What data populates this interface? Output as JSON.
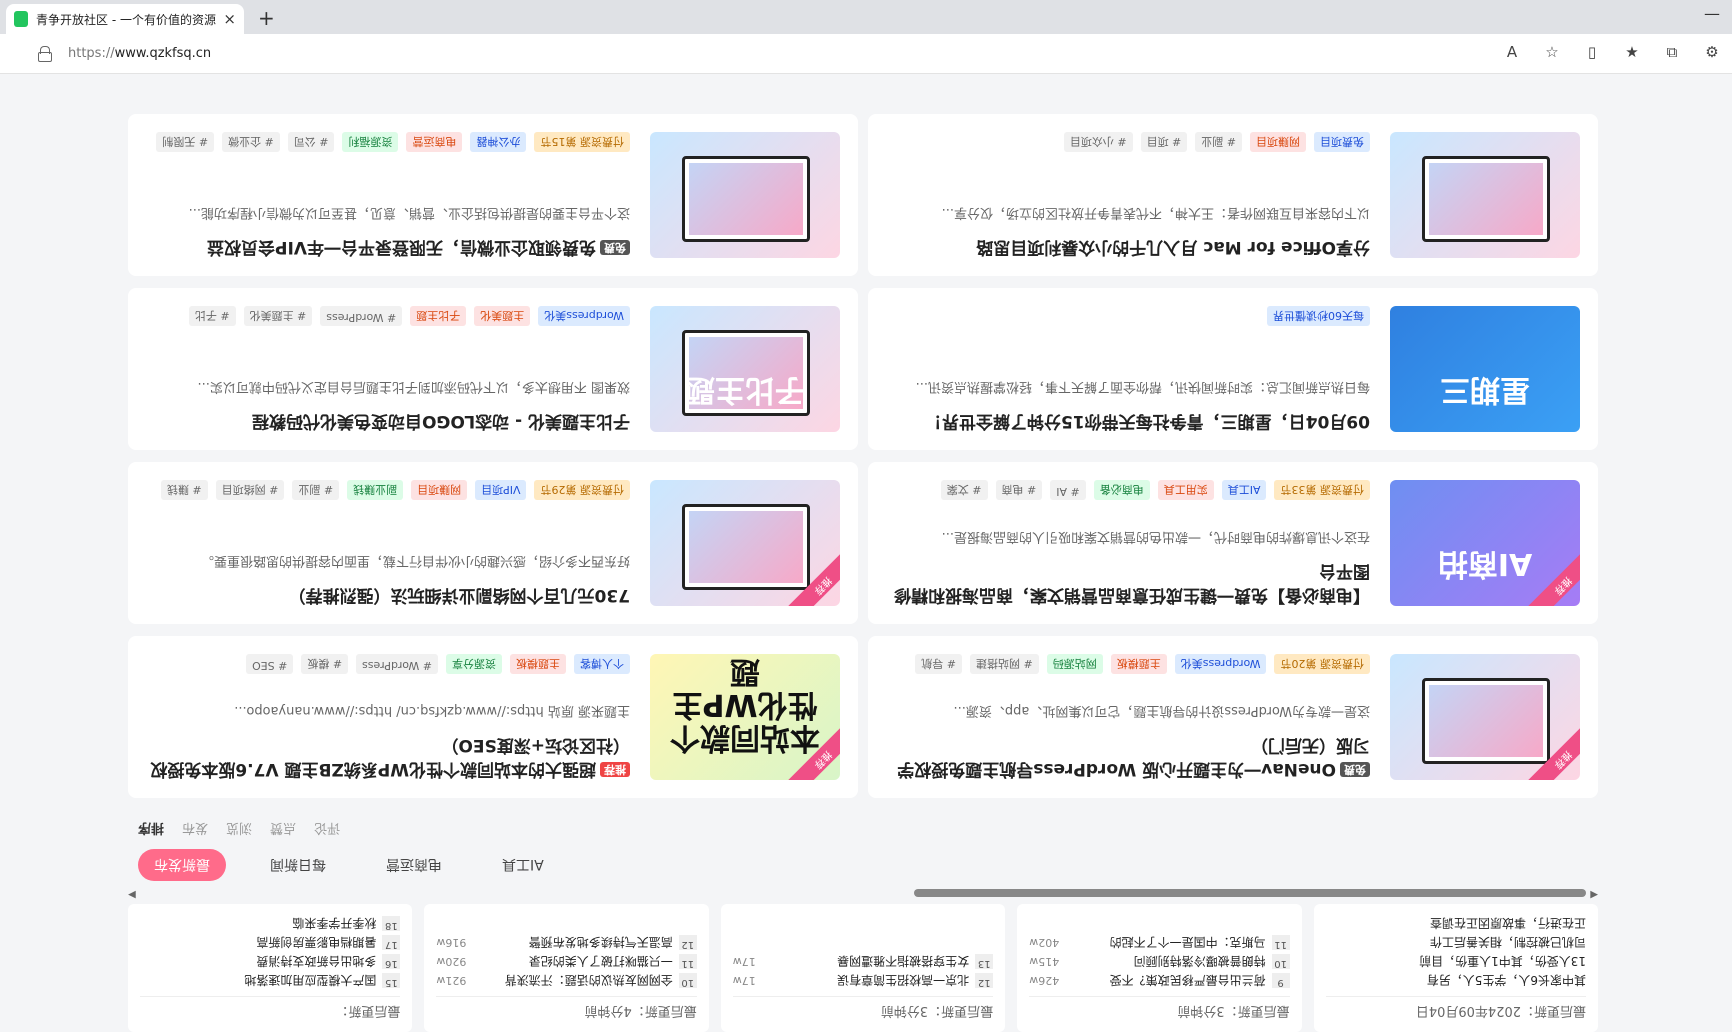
{
  "browser": {
    "tab_title": "青争开放社区 - 一个有价值的资源",
    "tab_close": "×",
    "new_tab": "+",
    "minimize": "—",
    "url_proto": "https://",
    "url_host": "www.qzkfsq.cn",
    "toolbar_icons": [
      "read-aloud-icon",
      "favorite-star-icon",
      "split-screen-icon",
      "favorites-icon",
      "collections-icon",
      "extensions-icon"
    ]
  },
  "updates": [
    {
      "title": "最后更新：2024年09月04日",
      "items": [
        {
          "num": "",
          "text": "其中家长6人，学生5人，另有",
          "heat": ""
        },
        {
          "num": "",
          "text": "13人受伤，其中1人重伤，目前",
          "heat": ""
        },
        {
          "num": "",
          "text": "司机已被控制，相关善后工作",
          "heat": ""
        },
        {
          "num": "",
          "text": "正在进行，事故原因正在调查",
          "heat": ""
        }
      ]
    },
    {
      "title": "最后更新：3分钟前",
      "items": [
        {
          "num": "9",
          "text": "荷兰出台最严移民政策？不受",
          "heat": "426w"
        },
        {
          "num": "10",
          "text": "特朗普被曝冷落特别顾问",
          "heat": "415w"
        },
        {
          "num": "11",
          "text": "马斯克：中国是一个了不起的",
          "heat": "402w"
        }
      ]
    },
    {
      "title": "最后更新：3分钟前",
      "items": [
        {
          "num": "12",
          "text": "北京一高校招生简章有误",
          "heat": "17w"
        },
        {
          "num": "13",
          "text": "女生穿搭被指不雅遭网暴",
          "heat": "17w"
        }
      ]
    },
    {
      "title": "最后更新：4分钟前",
      "items": [
        {
          "num": "10",
          "text": "全网网友热议的话题：汗流浃背",
          "heat": "921w"
        },
        {
          "num": "11",
          "text": "一只猫咪打破了人类的纪录",
          "heat": "920w"
        },
        {
          "num": "12",
          "text": "高温天气持续多地发布预警",
          "heat": "916w"
        }
      ]
    },
    {
      "title": "最后更新：",
      "items": [
        {
          "num": "15",
          "text": "国产大模型应用加速落地",
          "heat": ""
        },
        {
          "num": "16",
          "text": "多地出台新政支持消费",
          "heat": ""
        },
        {
          "num": "17",
          "text": "暑期档电影票房创新高",
          "heat": ""
        },
        {
          "num": "18",
          "text": "秋季开学季来临",
          "heat": ""
        }
      ]
    }
  ],
  "categories": [
    {
      "label": "最新发布",
      "active": true
    },
    {
      "label": "每日新闻",
      "active": false
    },
    {
      "label": "电商运营",
      "active": false
    },
    {
      "label": "AI工具",
      "active": false
    }
  ],
  "sort": {
    "label": "排序",
    "options": [
      "发布",
      "浏览",
      "点赞",
      "评论"
    ]
  },
  "cards": [
    {
      "badge": "免费",
      "title": "OneNav一为主题开心版 WordPress导航主题免授权学习版（无后门）",
      "desc": "这是一款专为WordPress设计的导航主题，它可以集网址、app、资源...",
      "tags": [
        {
          "text": "付费资源 第20节",
          "color": "orange"
        },
        {
          "text": "Wordpress美化",
          "color": "blue"
        },
        {
          "text": "主题模板",
          "color": "red"
        },
        {
          "text": "网站源码",
          "color": "green"
        },
        {
          "text": "# 网站搭建",
          "color": "gray"
        },
        {
          "text": "# 导航",
          "color": "gray"
        }
      ],
      "thumb": "pink",
      "ribbon": "推荐",
      "thumb_text": ""
    },
    {
      "badge": "推荐",
      "title": "超强大的本站同款个性化WP系统ZB主题 V7.6版本免授权（社区论坛+深度SEO）",
      "desc": "主题来源 原站 https://www.qzkfsq.cn/ https://www.nanyaopo...",
      "tags": [
        {
          "text": "个人博客",
          "color": "blue"
        },
        {
          "text": "主题模板",
          "color": "red"
        },
        {
          "text": "资源分享",
          "color": "green"
        },
        {
          "text": "# WordPress",
          "color": "gray"
        },
        {
          "text": "# 模板",
          "color": "gray"
        },
        {
          "text": "# SEO",
          "color": "gray"
        }
      ],
      "thumb": "green",
      "ribbon": "推荐",
      "thumb_text": "本站同款个性化WP主题"
    },
    {
      "badge": "",
      "title": "【电商必备】免费一键生成任意商品营销文案，商品海报和精修图平台",
      "desc": "在这个讯息爆炸的电商时代，一款出色的营销文案和吸引人的商品海报是...",
      "tags": [
        {
          "text": "付费资源 第33节",
          "color": "orange"
        },
        {
          "text": "AI工具",
          "color": "blue"
        },
        {
          "text": "实用工具",
          "color": "red"
        },
        {
          "text": "电商必备",
          "color": "green"
        },
        {
          "text": "# AI",
          "color": "gray"
        },
        {
          "text": "# 电商",
          "color": "gray"
        },
        {
          "text": "# 文案",
          "color": "gray"
        }
      ],
      "thumb": "purple",
      "ribbon": "推荐",
      "thumb_text": "AI商拍"
    },
    {
      "badge": "",
      "title": "730元几百个网络副业详细玩法（强烈推荐）",
      "desc": "好东西不多介绍，感兴趣的小伙伴自行下载，里面内容提供的思路很重要。",
      "tags": [
        {
          "text": "付费资源 第29节",
          "color": "orange"
        },
        {
          "text": "VIP项目",
          "color": "blue"
        },
        {
          "text": "网赚项目",
          "color": "red"
        },
        {
          "text": "副业赚钱",
          "color": "green"
        },
        {
          "text": "# 副业",
          "color": "gray"
        },
        {
          "text": "# 网络项目",
          "color": "gray"
        },
        {
          "text": "# 赚钱",
          "color": "gray"
        }
      ],
      "thumb": "pink",
      "ribbon": "推荐",
      "thumb_text": ""
    },
    {
      "badge": "",
      "title": "09月04日，星期三，青争社每天带你15分钟了解全世界！",
      "desc": "每日热点新闻汇总：实时新闻快讯，帮你全面了解天下事，轻松掌握热点资讯...",
      "tags": [
        {
          "text": "每天60秒读懂世界",
          "color": "blue"
        }
      ],
      "thumb": "blue",
      "ribbon": "",
      "thumb_text": "星期三"
    },
    {
      "badge": "",
      "title": "子比主题美化 - 动态LOGO自动变色美化代码教程",
      "desc": "效果图 不用想太多，以下代码添加到子比主题后台自定义代码中就可以实...",
      "tags": [
        {
          "text": "Wordpress美化",
          "color": "blue"
        },
        {
          "text": "主题美化",
          "color": "red"
        },
        {
          "text": "子比主题",
          "color": "red"
        },
        {
          "text": "# WordPress",
          "color": "gray"
        },
        {
          "text": "# 主题美化",
          "color": "gray"
        },
        {
          "text": "# 子比",
          "color": "gray"
        }
      ],
      "thumb": "pink",
      "ribbon": "",
      "thumb_text": "子比主题"
    },
    {
      "badge": "",
      "title": "分享Office for Mac 月入几千的小众暴利项目思路",
      "desc": "以下内容来自互联网作者：王大神，不代表青争开放社区的立场，仅分享...",
      "tags": [
        {
          "text": "免费项目",
          "color": "blue"
        },
        {
          "text": "网赚项目",
          "color": "red"
        },
        {
          "text": "# 副业",
          "color": "gray"
        },
        {
          "text": "# 项目",
          "color": "gray"
        },
        {
          "text": "# 小众项目",
          "color": "gray"
        }
      ],
      "thumb": "pink",
      "ribbon": "",
      "thumb_text": ""
    },
    {
      "badge": "免费",
      "title": "免费领取企业微信，无限登录平台一年VIP会员权益",
      "desc": "这个平台主要的是提供包括企业、营销、意见，甚至可以为微信小程序功能...",
      "tags": [
        {
          "text": "付费资源 第15节",
          "color": "orange"
        },
        {
          "text": "办公神器",
          "color": "blue"
        },
        {
          "text": "电商运营",
          "color": "red"
        },
        {
          "text": "资源福利",
          "color": "green"
        },
        {
          "text": "# 公司",
          "color": "gray"
        },
        {
          "text": "# 企业微",
          "color": "gray"
        },
        {
          "text": "# 无限制",
          "color": "gray"
        }
      ],
      "thumb": "pink",
      "ribbon": "",
      "thumb_text": ""
    }
  ]
}
